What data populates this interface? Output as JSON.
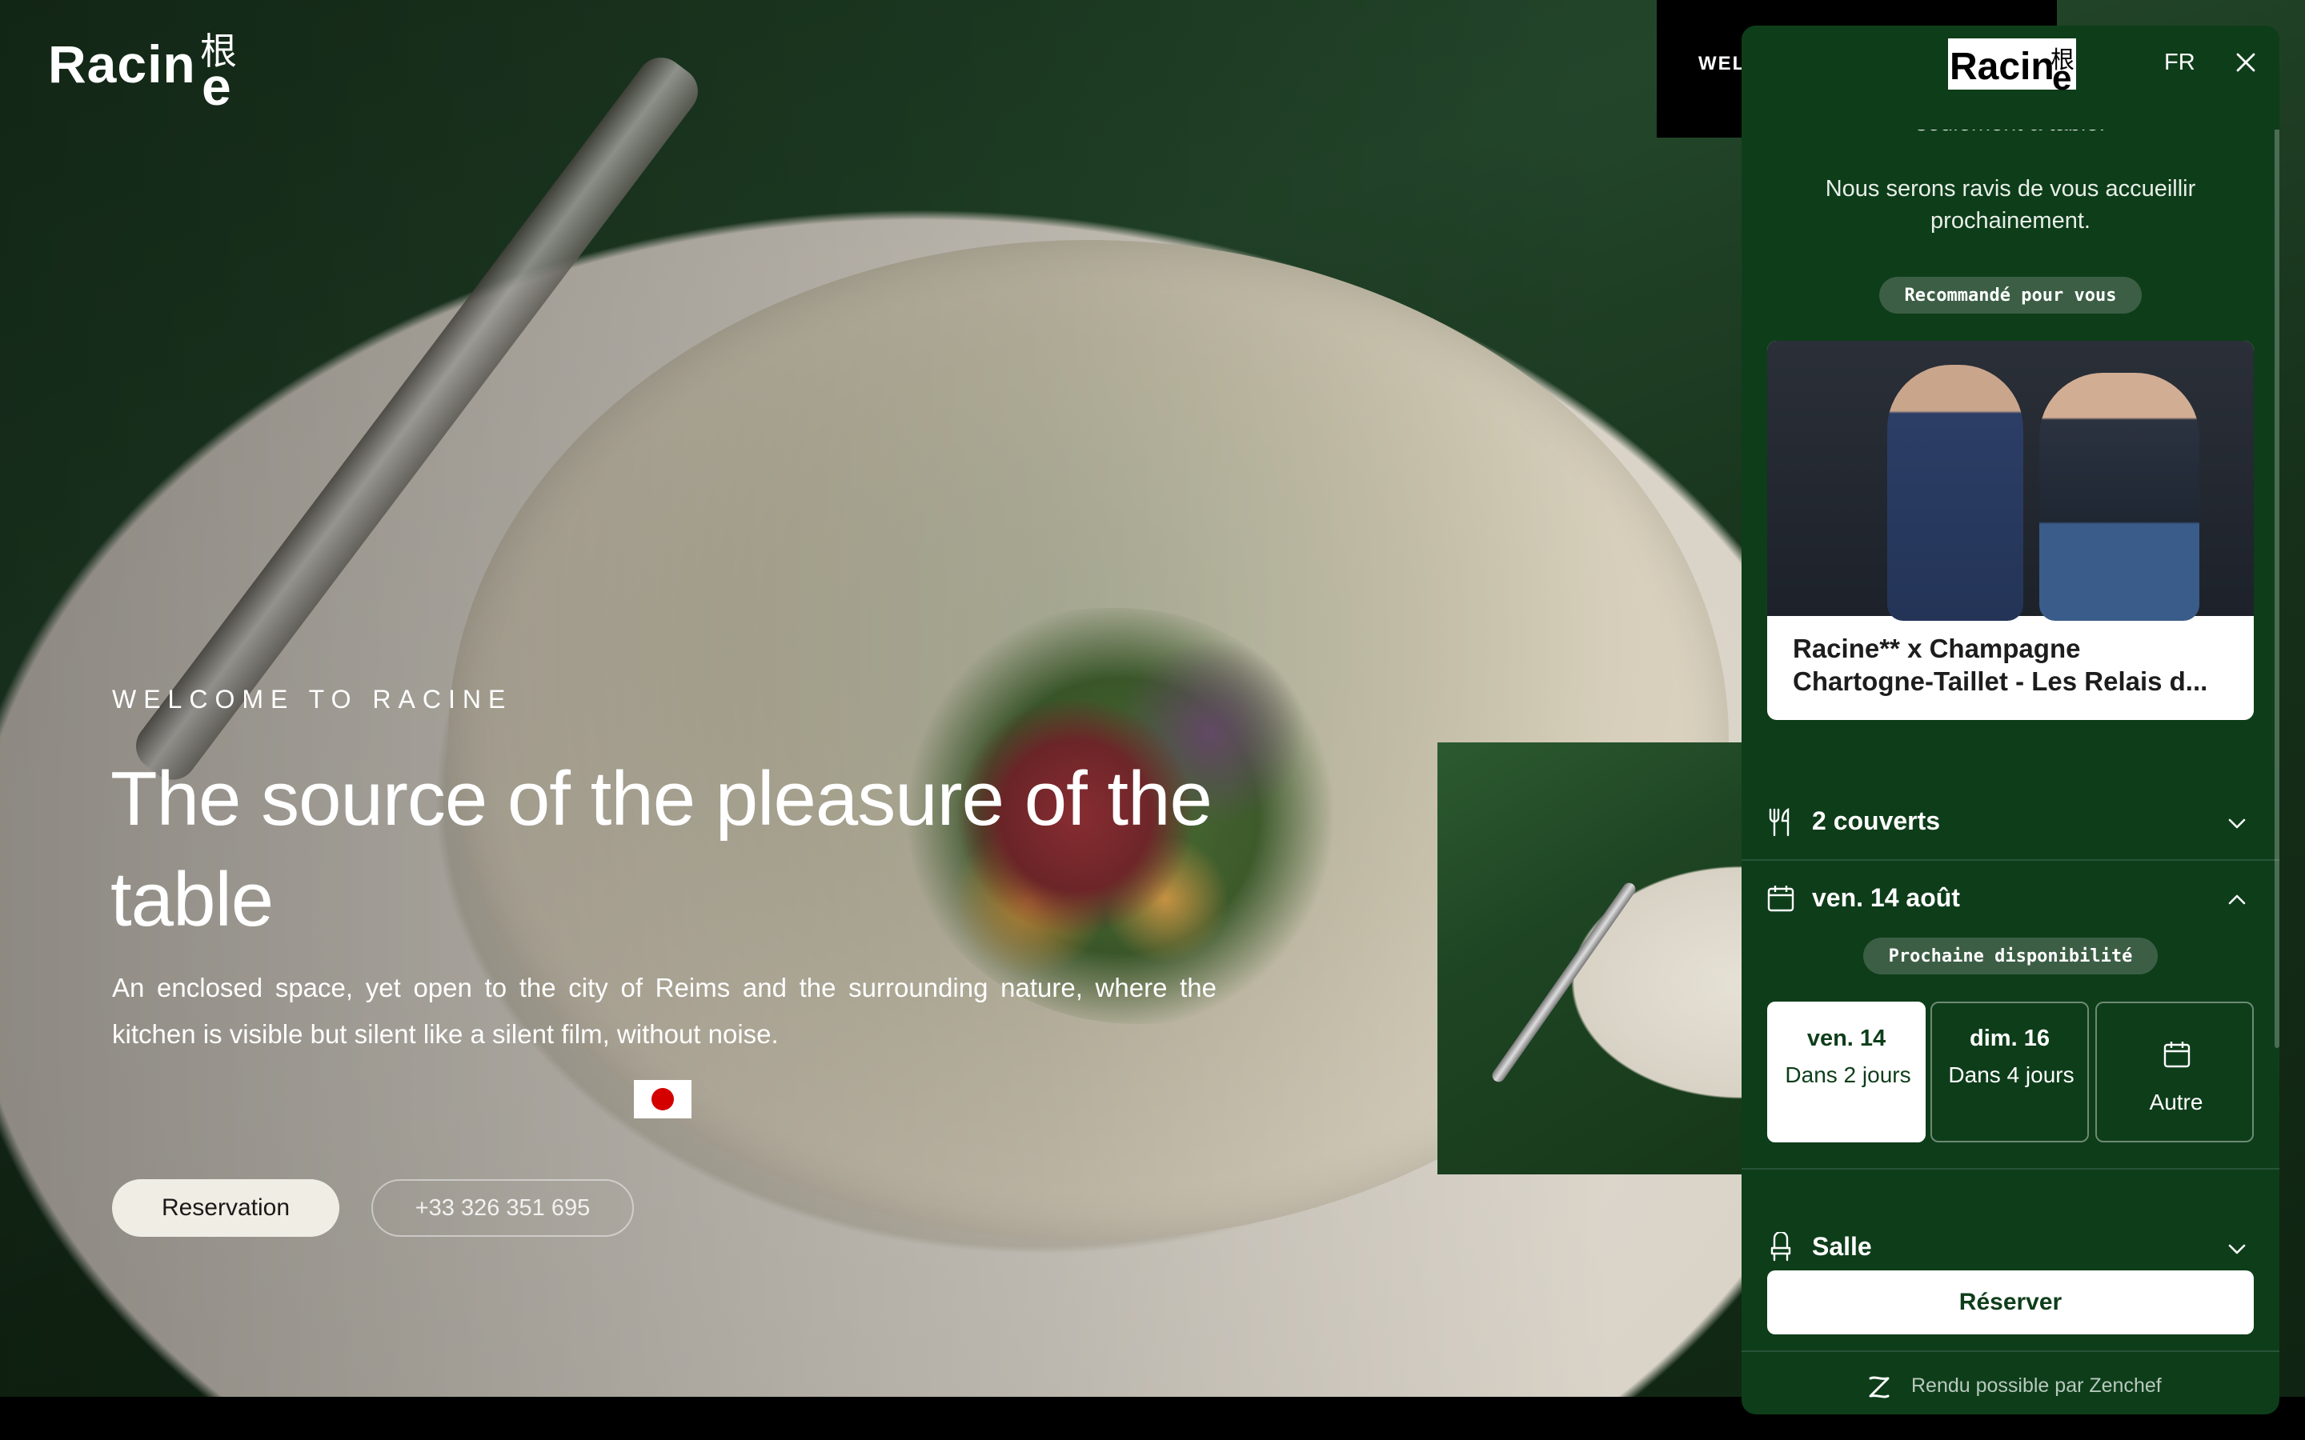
{
  "site": {
    "logo_word": "Racin",
    "logo_kanji": "根",
    "logo_e": "e",
    "nav_partial": "WEL"
  },
  "hero": {
    "eyebrow": "WELCOME TO RACINE",
    "title": "The source of the pleasure of the table",
    "description": "An enclosed space, yet open to the city of Reims and the surrounding nature, where the kitchen is visible but silent like a silent film, without noise.",
    "reservation_label": "Reservation",
    "phone_label": "+33 326 351 695"
  },
  "panel": {
    "logo_word": "Racin",
    "logo_kanji": "根",
    "logo_e": "e",
    "language": "FR",
    "intro_line1": "seulement à table.",
    "intro_line2": "Nous serons ravis de vous accueillir prochainement.",
    "recommended_pill": "Recommandé pour vous",
    "card": {
      "title_line1": "Racine** x Champagne",
      "title_line2": "Chartogne-Taillet - Les Relais d..."
    },
    "guests_label": "2 couverts",
    "date_label": "ven. 14 août",
    "next_availability_pill": "Prochaine disponibilité",
    "date_options": [
      {
        "day": "ven. 14",
        "sub": "Dans 2 jours",
        "selected": true
      },
      {
        "day": "dim. 16",
        "sub": "Dans 4 jours",
        "selected": false
      },
      {
        "day": "",
        "sub": "Autre",
        "selected": false
      }
    ],
    "room_label": "Salle",
    "reserve_label": "Réserver",
    "footer_text": "Rendu possible par Zenchef"
  },
  "colors": {
    "panel_bg": "#0e3d1a",
    "pill_bg": "#3c5e45",
    "flag_red": "#d40000"
  }
}
